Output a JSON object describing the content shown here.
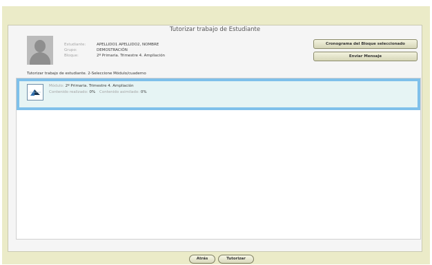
{
  "page": {
    "title": "Tutorizar trabajo de Estudiante"
  },
  "student": {
    "fields": [
      {
        "label": "Estudiante:",
        "value": "APELLIDO1 APELLIDO2, NOMBRE"
      },
      {
        "label": "Grupo:",
        "value": "DEMOSTRACIÓN"
      },
      {
        "label": "Bloque:",
        "value": "2º Primaria. Trimestre 4. Ampliación"
      }
    ]
  },
  "actions": {
    "cronograma_label": "Cronograma del Bloque seleccionado",
    "mensaje_label": "Enviar Mensaje"
  },
  "instruction": "Tutorizar trabajo de estudiante. 2-Seleccione Módulo/cuaderno",
  "modules": [
    {
      "module_label": "Módulo:",
      "module_value": "2º Primaria. Trimestre 4. Ampliación",
      "realizado_label": "Contenido realizado:",
      "realizado_value": "0%",
      "asimilado_label": "Contenido asimilado:",
      "asimilado_value": "0%",
      "icon": "module-icon"
    }
  ],
  "footer": {
    "back_label": "Atrás",
    "tutor_label": "Tutorizar"
  },
  "colors": {
    "selection_border": "#7fc0ea",
    "selection_fill": "#e6f4f4",
    "frame": "#ebebc8"
  }
}
